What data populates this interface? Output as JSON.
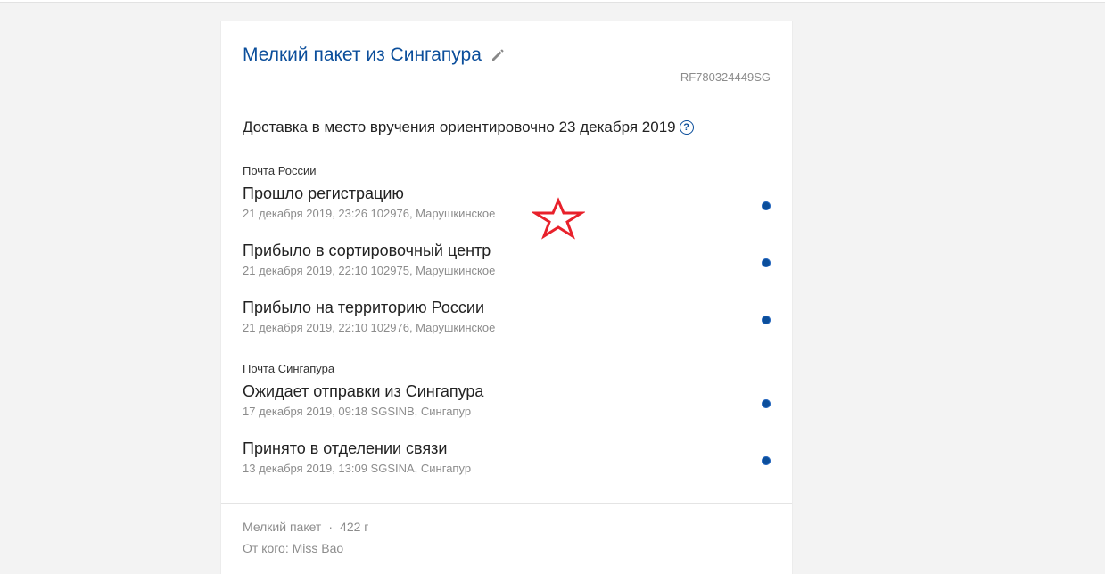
{
  "card": {
    "title": "Мелкий пакет из Сингапура",
    "tracking_number": "RF780324449SG",
    "delivery_estimate": "Доставка в место вручения ориентировочно 23 декабря 2019",
    "help_symbol": "?"
  },
  "groups": [
    {
      "carrier": "Почта России",
      "events": [
        {
          "title": "Прошло регистрацию",
          "meta": "21 декабря 2019, 23:26 102976, Марушкинское"
        },
        {
          "title": "Прибыло в сортировочный центр",
          "meta": "21 декабря 2019, 22:10 102975, Марушкинское"
        },
        {
          "title": "Прибыло на территорию России",
          "meta": "21 декабря 2019, 22:10 102976, Марушкинское"
        }
      ]
    },
    {
      "carrier": "Почта Сингапура",
      "events": [
        {
          "title": "Ожидает отправки из Сингапура",
          "meta": "17 декабря 2019, 09:18 SGSINB, Сингапур"
        },
        {
          "title": "Принято в отделении связи",
          "meta": "13 декабря 2019, 13:09 SGSINA, Сингапур"
        }
      ]
    }
  ],
  "footer": {
    "package_type": "Мелкий пакет",
    "separator": "·",
    "weight": "422 г",
    "sender": "От кого: Miss Bao"
  },
  "colors": {
    "accent": "#0b4e9b",
    "star": "#e8212b"
  },
  "icons": [
    "pencil-icon",
    "help-icon",
    "status-dot-icon",
    "star-annotation"
  ]
}
